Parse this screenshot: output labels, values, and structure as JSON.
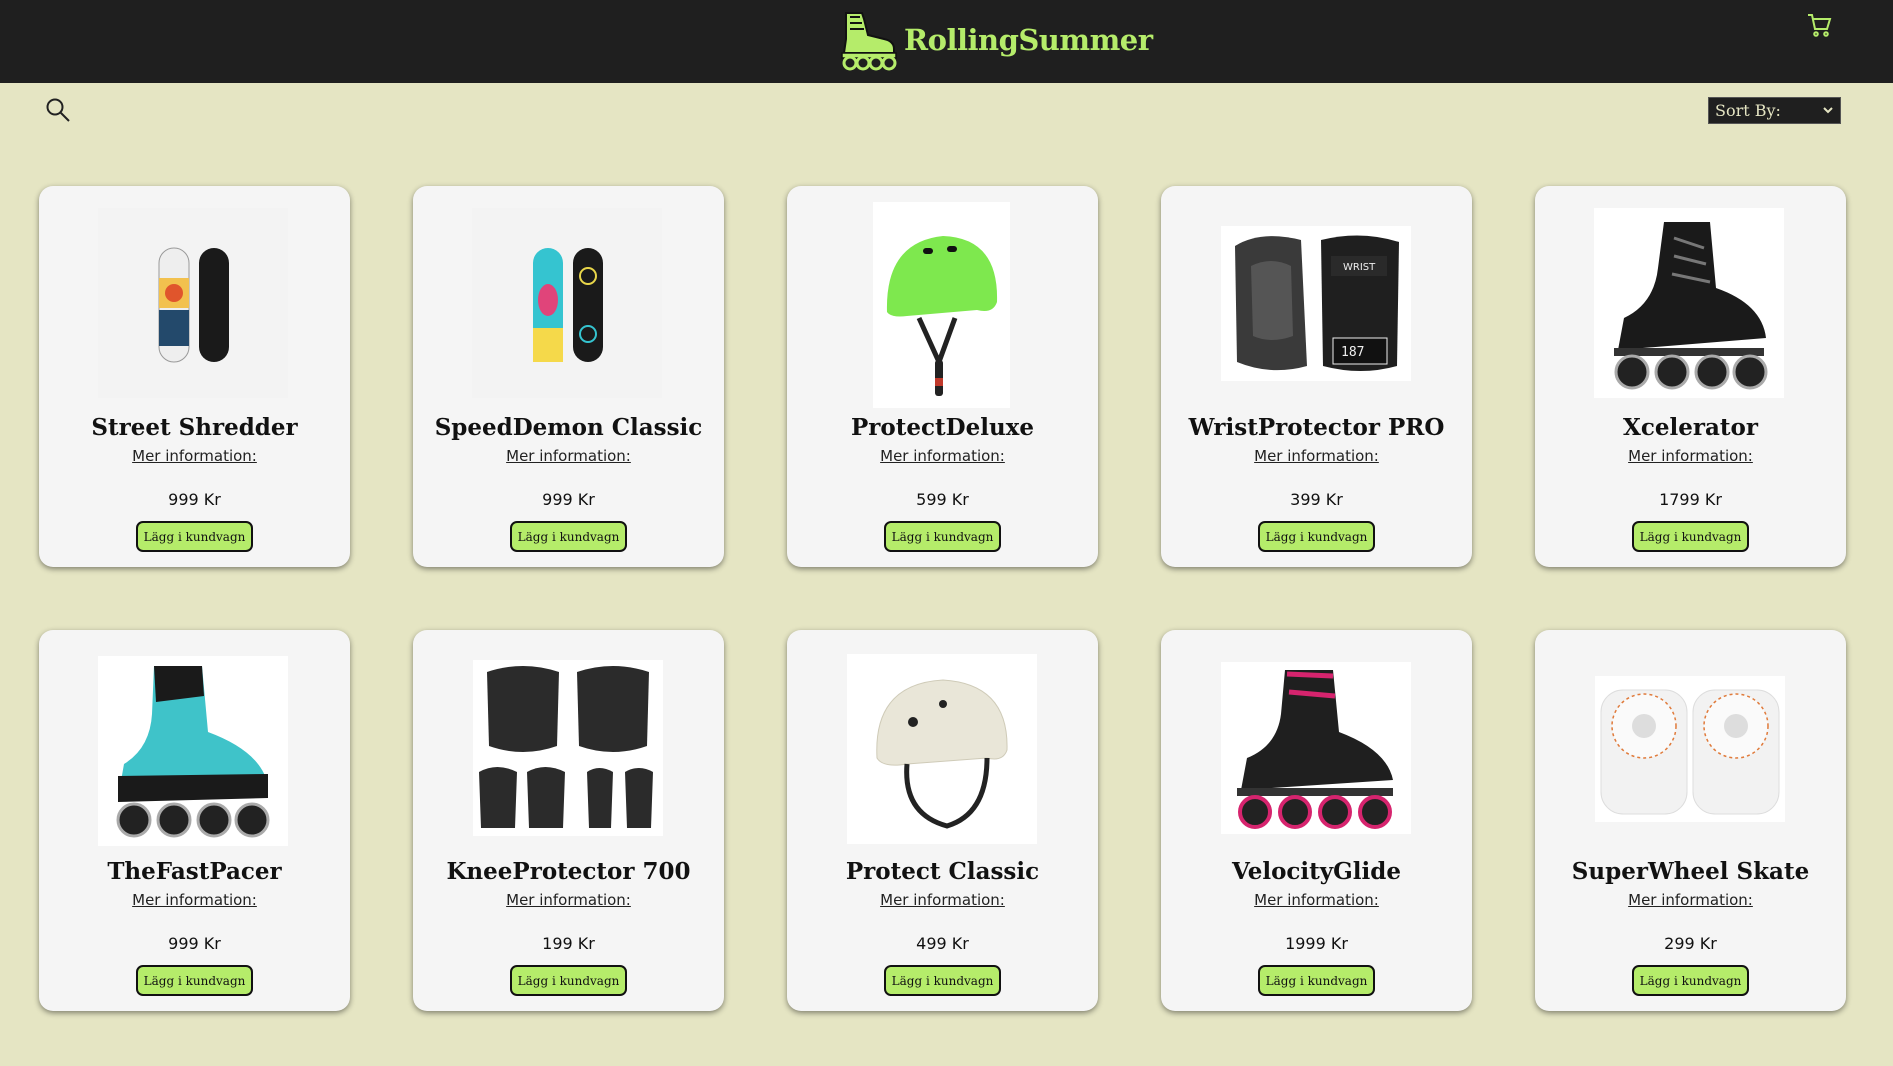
{
  "header": {
    "brand": "RollingSummer",
    "brand_color": "#b5ec6a",
    "logo_icon": "rollerskate-icon",
    "cart_icon": "shopping-cart-icon"
  },
  "toolbar": {
    "search_icon": "search-icon",
    "sort_label": "Sort By:"
  },
  "theme": {
    "background": "#e5e5c3",
    "topbar": "#1f1f1f",
    "card": "#f5f5f5",
    "button": "#b5ec6a"
  },
  "products": [
    {
      "name": "Street Shredder",
      "more": "Mer information:",
      "price": "999 Kr",
      "button": "Lägg i kundvagn",
      "image": "skateboard-image"
    },
    {
      "name": "SpeedDemon Classic",
      "more": "Mer information:",
      "price": "999 Kr",
      "button": "Lägg i kundvagn",
      "image": "skateboard-image"
    },
    {
      "name": "ProtectDeluxe",
      "more": "Mer information:",
      "price": "599 Kr",
      "button": "Lägg i kundvagn",
      "image": "helmet-image"
    },
    {
      "name": "WristProtector PRO",
      "more": "Mer information:",
      "price": "399 Kr",
      "button": "Lägg i kundvagn",
      "image": "wrist-guard-image"
    },
    {
      "name": "Xcelerator",
      "more": "Mer information:",
      "price": "1799 Kr",
      "button": "Lägg i kundvagn",
      "image": "inline-skate-image"
    },
    {
      "name": "TheFastPacer",
      "more": "Mer information:",
      "price": "999 Kr",
      "button": "Lägg i kundvagn",
      "image": "inline-skate-image"
    },
    {
      "name": "KneeProtector 700",
      "more": "Mer information:",
      "price": "199 Kr",
      "button": "Lägg i kundvagn",
      "image": "knee-pads-image"
    },
    {
      "name": "Protect Classic",
      "more": "Mer information:",
      "price": "499 Kr",
      "button": "Lägg i kundvagn",
      "image": "helmet-image"
    },
    {
      "name": "VelocityGlide",
      "more": "Mer information:",
      "price": "1999 Kr",
      "button": "Lägg i kundvagn",
      "image": "inline-skate-image"
    },
    {
      "name": "SuperWheel Skate",
      "more": "Mer information:",
      "price": "299 Kr",
      "button": "Lägg i kundvagn",
      "image": "skate-wheels-image"
    }
  ]
}
